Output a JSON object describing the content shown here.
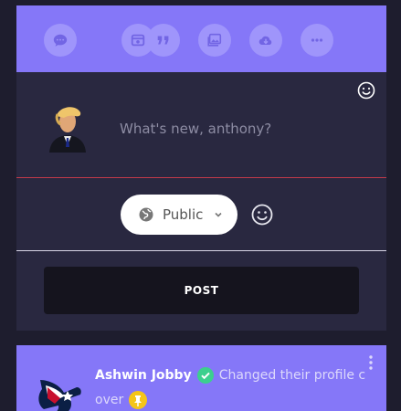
{
  "toolbar": {
    "items": [
      {
        "icon": "message-icon"
      },
      {
        "icon": "media-icon"
      },
      {
        "icon": "quote-icon"
      },
      {
        "icon": "gallery-icon"
      },
      {
        "icon": "cloud-download-icon"
      },
      {
        "icon": "more-icon"
      }
    ]
  },
  "composer": {
    "placeholder": "What's new, anthony?",
    "privacy_label": "Public",
    "post_label": "POST"
  },
  "feed": {
    "author": "Ashwin Jobby",
    "action": "Changed their profile c",
    "continuation": "over"
  },
  "colors": {
    "accent": "#8577f8",
    "card": "#292840",
    "background": "#1e1d2e",
    "verified": "#3ccf8e",
    "pin": "#f5c518"
  }
}
